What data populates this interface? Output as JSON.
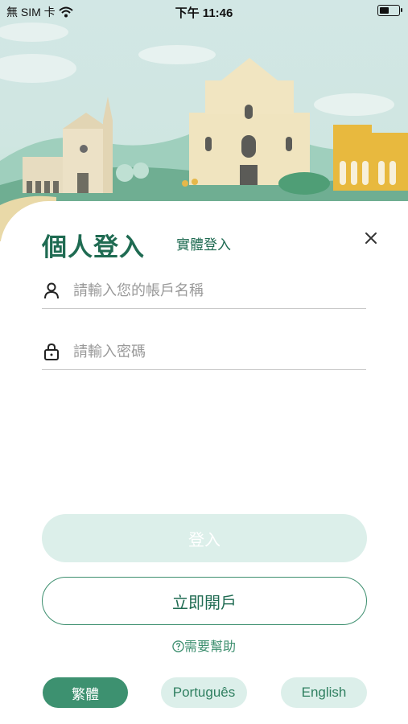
{
  "status_bar": {
    "carrier": "無 SIM 卡",
    "time": "下午 11:46"
  },
  "login": {
    "title": "個人登入",
    "alt_tab": "實體登入",
    "username_placeholder": "請輸入您的帳戶名稱",
    "password_placeholder": "請輸入密碼",
    "login_button": "登入",
    "register_button": "立即開戶",
    "help_text": "需要幫助"
  },
  "languages": [
    {
      "label": "繁體",
      "selected": true
    },
    {
      "label": "Português",
      "selected": false
    },
    {
      "label": "English",
      "selected": false
    }
  ],
  "colors": {
    "primary": "#3d9170",
    "primary_light": "#dcefea",
    "title": "#1f6b52"
  },
  "icons": [
    "wifi-icon",
    "battery-icon",
    "close-icon",
    "user-icon",
    "lock-icon",
    "help-circle-icon"
  ]
}
